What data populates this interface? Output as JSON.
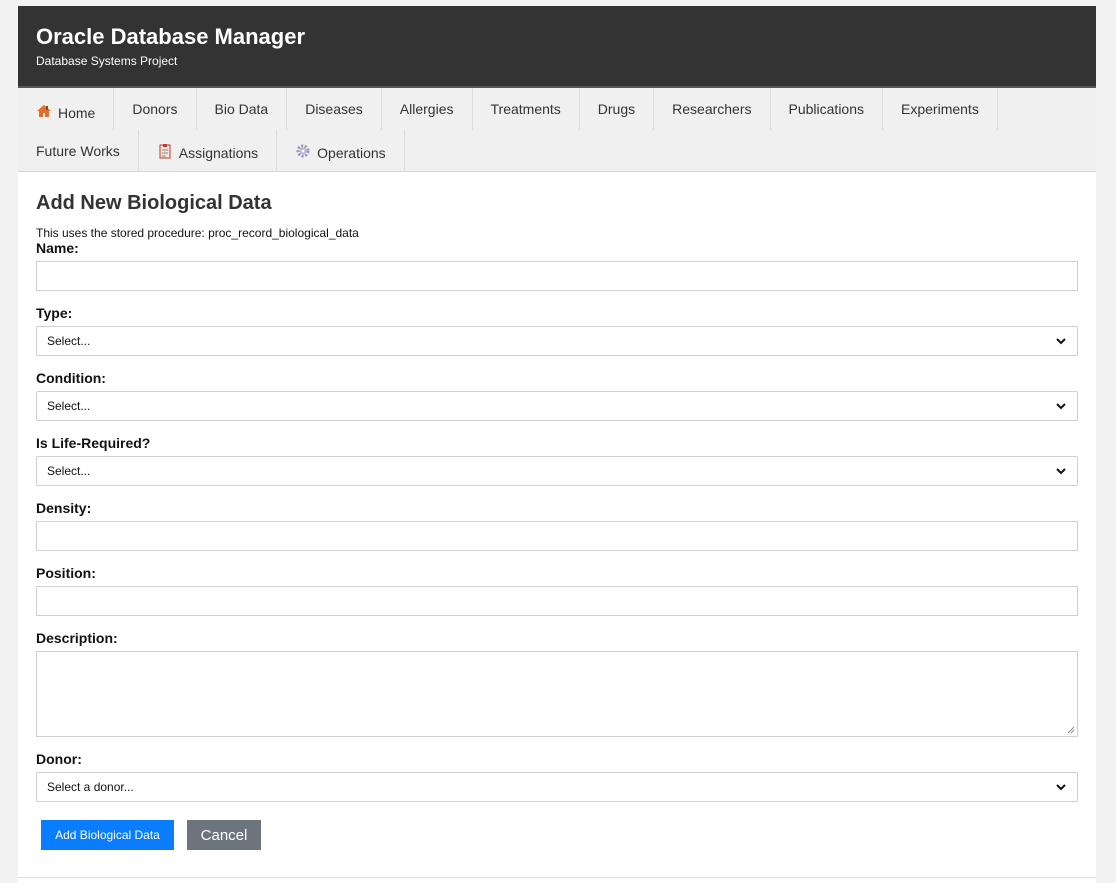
{
  "header": {
    "title": "Oracle Database Manager",
    "subtitle": "Database Systems Project"
  },
  "nav": {
    "items": [
      {
        "label": "Home",
        "icon": "house-icon"
      },
      {
        "label": "Donors"
      },
      {
        "label": "Bio Data"
      },
      {
        "label": "Diseases"
      },
      {
        "label": "Allergies"
      },
      {
        "label": "Treatments"
      },
      {
        "label": "Drugs"
      },
      {
        "label": "Researchers"
      },
      {
        "label": "Publications"
      },
      {
        "label": "Experiments"
      },
      {
        "label": "Future Works"
      },
      {
        "label": "Assignations",
        "icon": "clipboard-icon"
      },
      {
        "label": "Operations",
        "icon": "gear-icon"
      }
    ]
  },
  "form": {
    "title": "Add New Biological Data",
    "note": "This uses the stored procedure: proc_record_biological_data",
    "name_label": "Name:",
    "name_value": "",
    "type_label": "Type:",
    "type_selected": "Select...",
    "condition_label": "Condition:",
    "condition_selected": "Select...",
    "life_required_label": "Is Life-Required?",
    "life_required_selected": "Select...",
    "density_label": "Density:",
    "density_value": "",
    "position_label": "Position:",
    "position_value": "",
    "description_label": "Description:",
    "description_value": "",
    "donor_label": "Donor:",
    "donor_selected": "Select a donor...",
    "submit_label": "Add Biological Data",
    "cancel_label": "Cancel"
  },
  "colors": {
    "header_bg": "#333333",
    "primary_button": "#0a7cff",
    "secondary_button": "#6c757d"
  }
}
